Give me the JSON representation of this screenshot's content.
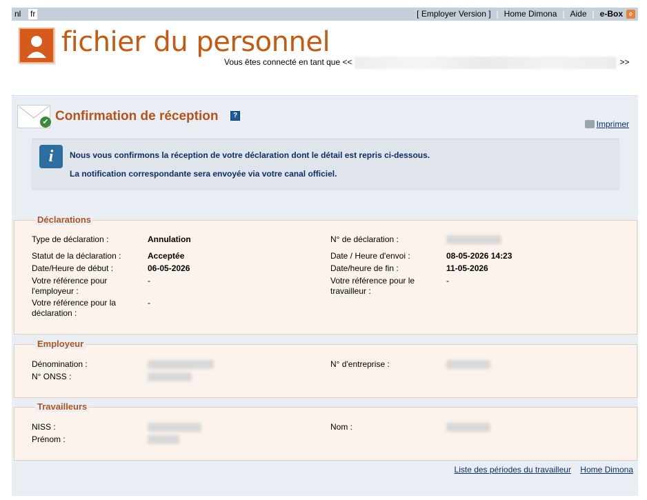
{
  "topbar": {
    "lang_nl": "nl",
    "lang_fr": "fr",
    "employer_version": "[ Employer Version ]",
    "home_dimona": "Home Dimona",
    "aide": "Aide",
    "ebox": "e-Box",
    "ebox_icon": "e"
  },
  "header": {
    "logo_title": "fichier du personnel",
    "connected_prefix": "Vous êtes connecté en tant que <<",
    "connected_suffix": ">>"
  },
  "page": {
    "title": "Confirmation de réception",
    "help_icon": "?",
    "print": "Imprimer"
  },
  "info": {
    "icon": "i",
    "line1": "Nous vous confirmons la réception de votre déclaration dont le détail est repris ci-dessous.",
    "line2": "La notification correspondante sera envoyée via votre canal officiel."
  },
  "declarations": {
    "legend": "Déclarations",
    "type_label": "Type de déclaration :",
    "type_value": "Annulation",
    "num_label": "N° de déclaration :",
    "statut_label": "Statut de la déclaration :",
    "statut_value": "Acceptée",
    "envoi_label": "Date / Heure d'envoi :",
    "envoi_value": "08-05-2026 14:23",
    "debut_label": "Date/Heure de début :",
    "debut_value": "06-05-2026",
    "fin_label": "Date/heure de fin :",
    "fin_value": "11-05-2026",
    "ref_emp_label": "Votre référence pour l'employeur :",
    "ref_emp_value": "-",
    "ref_trav_label": "Votre référence pour le travailleur :",
    "ref_trav_value": "-",
    "ref_decl_label": "Votre référence pour la déclaration :",
    "ref_decl_value": "-"
  },
  "employeur": {
    "legend": "Employeur",
    "denom_label": "Dénomination :",
    "entreprise_label": "N° d'entreprise :",
    "onss_label": "N° ONSS :"
  },
  "travailleurs": {
    "legend": "Travailleurs",
    "niss_label": "NISS :",
    "nom_label": "Nom :",
    "prenom_label": "Prénom :"
  },
  "footer": {
    "periodes": "Liste des périodes du travailleur",
    "home_dimona": "Home Dimona"
  }
}
